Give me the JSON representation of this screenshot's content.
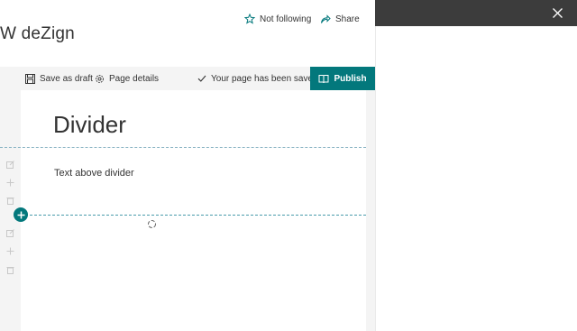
{
  "site": {
    "title": "W deZign"
  },
  "header_actions": {
    "follow_label": "Not following",
    "share_label": "Share"
  },
  "command_bar": {
    "save_draft_label": "Save as draft",
    "page_details_label": "Page details",
    "status_text": "Your page has been saved",
    "publish_label": "Publish"
  },
  "canvas": {
    "page_title": "Divider",
    "text_section": "Text above divider"
  },
  "colors": {
    "accent": "#03787c",
    "panel_header": "#3c3c3c"
  },
  "icons": [
    "star-icon",
    "share-icon",
    "save-icon",
    "gear-icon",
    "checkmark-icon",
    "book-icon",
    "edit-icon",
    "move-icon",
    "delete-icon",
    "add-icon",
    "loading-icon",
    "close-icon"
  ]
}
